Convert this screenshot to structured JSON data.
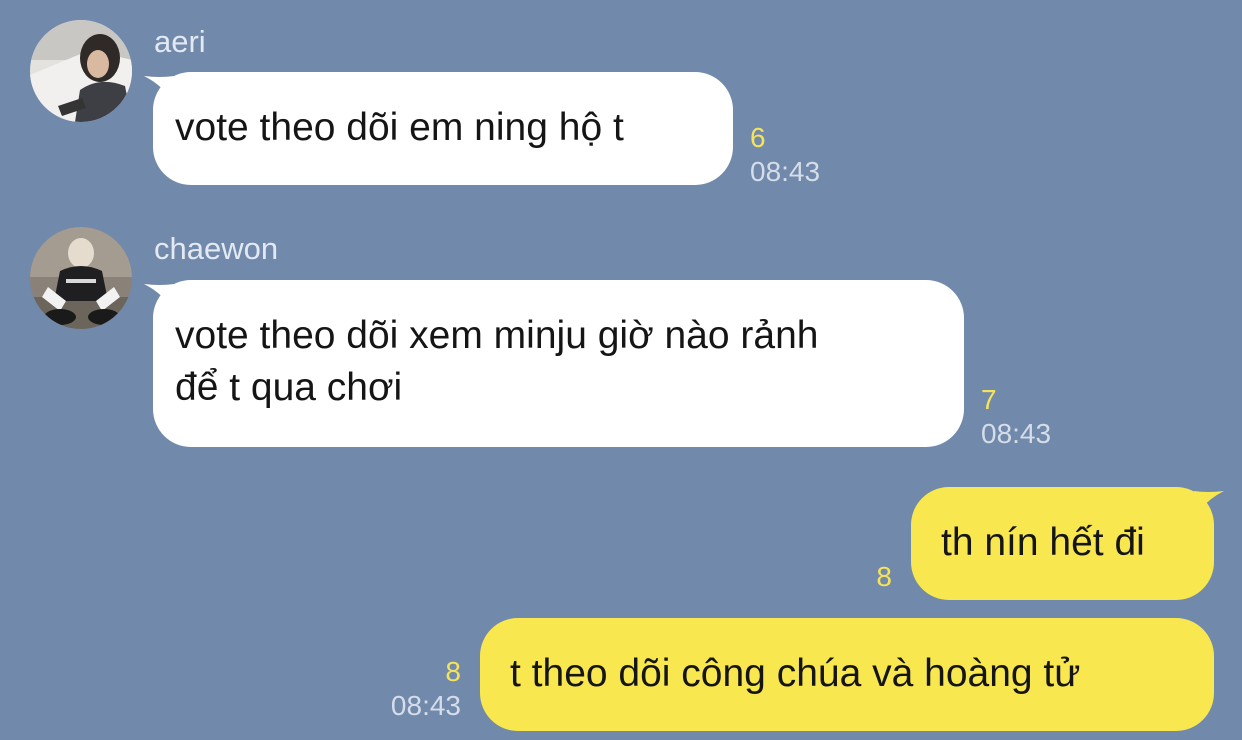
{
  "colors": {
    "background": "#7189ab",
    "incoming_bubble": "#ffffff",
    "outgoing_bubble": "#f9e74f",
    "unread_count": "#f6e35a",
    "timestamp": "#d5dde9",
    "sender_name": "#e3e9f3"
  },
  "messages": [
    {
      "sender": "aeri",
      "avatar": "avatar-photo",
      "text": "vote theo dõi em ning hộ t",
      "unread": "6",
      "time": "08:43"
    },
    {
      "sender": "chaewon",
      "avatar": "avatar-photo",
      "text_line1": "vote theo dõi xem minju giờ nào rảnh",
      "text_line2": "để t qua chơi",
      "unread": "7",
      "time": "08:43"
    },
    {
      "outgoing": true,
      "text": "th nín hết đi",
      "unread": "8"
    },
    {
      "outgoing": true,
      "text": "t theo dõi công chúa và hoàng tử",
      "unread": "8",
      "time": "08:43"
    }
  ]
}
